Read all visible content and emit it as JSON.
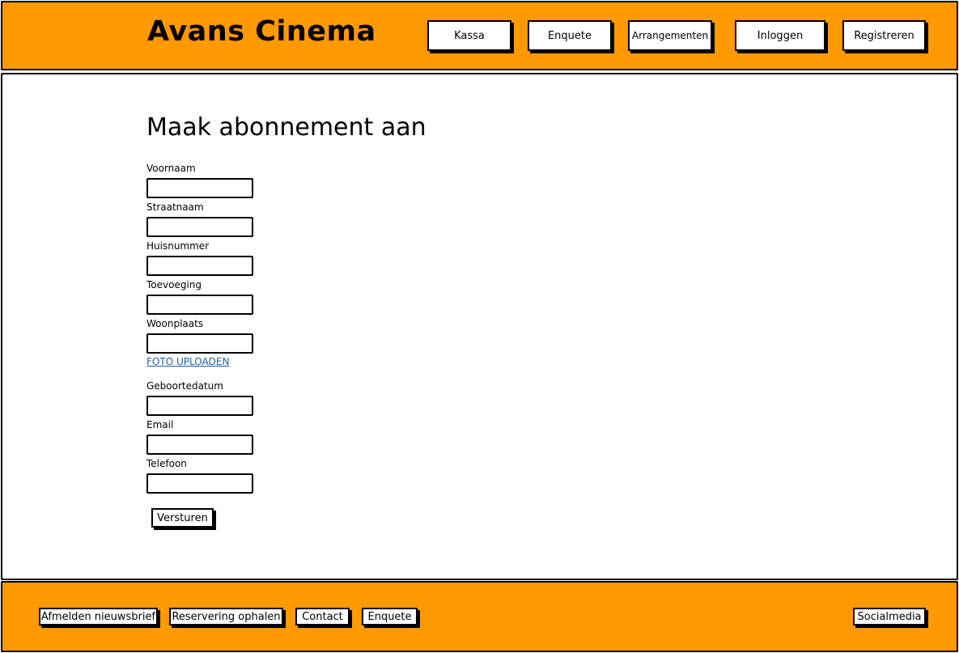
{
  "header": {
    "brand": "Avans Cinema",
    "nav": [
      "Kassa",
      "Enquete",
      "Arrangementen",
      "Inloggen",
      "Registreren"
    ]
  },
  "main": {
    "title": "Maak abonnement aan",
    "fields": {
      "voornaam": "Voornaam",
      "straatnaam": "Straatnaam",
      "huisnummer": "Huisnummer",
      "toevoeging": "Toevoeging",
      "woonplaats": "Woonplaats",
      "geboortedatum": "Geboortedatum",
      "email": "Email",
      "telefoon": "Telefoon"
    },
    "upload_link": "FOTO UPLOADEN",
    "submit_label": "Versturen"
  },
  "footer": {
    "links": [
      "Afmelden nieuwsbrief",
      "Reservering ophalen",
      "Contact",
      "Enquete"
    ],
    "social": "Socialmedia"
  },
  "colors": {
    "accent": "#ff9900",
    "link": "#1f5fa6"
  }
}
